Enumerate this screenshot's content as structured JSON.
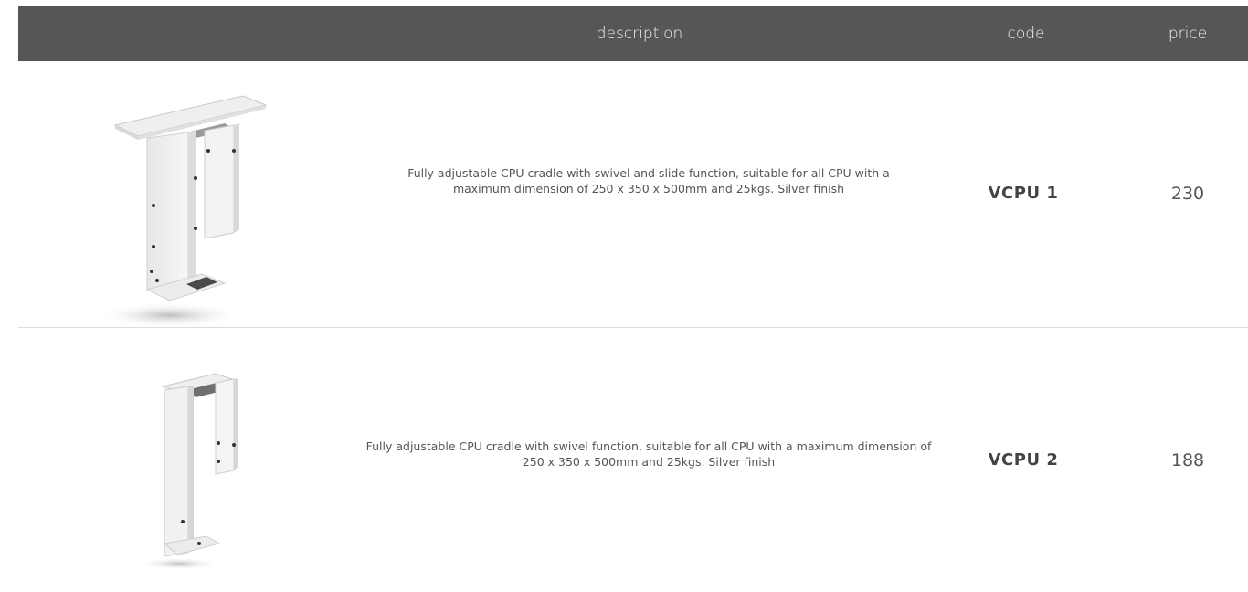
{
  "header": {
    "description_label": "description",
    "code_label": "code",
    "price_label": "price"
  },
  "products": [
    {
      "description": "Fully adjustable CPU cradle with swivel and slide function, suitable for all CPU with a maximum dimension of 250 x 350 x 500mm and 25kgs. Silver finish",
      "code": "VCPU 1",
      "price": "230"
    },
    {
      "description": "Fully adjustable CPU cradle with swivel function, suitable for all CPU with a maximum dimension of 250 x 350 x 500mm and 25kgs. Silver finish",
      "code": "VCPU 2",
      "price": "188"
    }
  ],
  "colors": {
    "header_bg": "#565656",
    "header_text": "#f2f2f2",
    "body_text": "#555555",
    "divider": "#dcdcdc"
  }
}
